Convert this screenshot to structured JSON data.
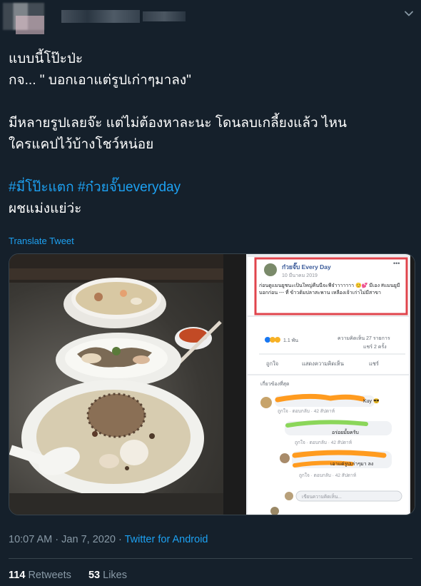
{
  "tweet": {
    "lines": [
      "แบบนี้โป๊ะป่ะ",
      "กจ... \" บอกเอาแต่รูปเก่าๆมาลง\"",
      "มีหลายรูปเลยจ๊ะ แต่ไม่ต้องหาละนะ โดนลบเกลี้ยงแล้ว ไหน",
      "ใครแคปไว้บ้างโชว์หน่อย",
      "ผชแม่งแย่ว่ะ"
    ],
    "hashtags": [
      "#มี่โป๊ะแตก",
      "#ก๋วยจั๊บeveryday"
    ]
  },
  "translate_label": "Translate Tweet",
  "screenshot_post": {
    "page_name": "ก๋วยจั๊บ Every Day",
    "date": "10 มีนาคม 2019",
    "body": "ก่อนดูแมนยูชนะเป็นใหญ่คืนนี้จะพี่จ๋าาาาาาา 😊💕 มีเอง #แมนยูมีบอกก่อน --- ที่ ข้าวต้มปลาสะพาน เหลืองเจ้าเก่าไม่มีสาขา",
    "reactions": "1.1 พัน",
    "comments_count": "ความคิดเห็น 27 รายการ",
    "shares": "แชร์ 2 ครั้ง",
    "like_label": "ถูกใจ",
    "comment_label": "แสดงความคิดเห็น",
    "share_label": "แชร์",
    "sort_label": "เกี่ยวข้องที่สุด",
    "c1_name": "Kuy 😎",
    "c1_meta": "ถูกใจ · ตอบกลับ · 42 สัปดาห์",
    "c2_text": "อร่อยมั้ยครับ",
    "c2_meta": "ถูกใจ · ตอบกลับ · 42 สัปดาห์",
    "c3_text": "เอาแต่รูปเก่าๆมา ลง",
    "c3_meta": "ถูกใจ · ตอบกลับ · 42 สัปดาห์",
    "input_placeholder": "เขียนความคิดเห็น..."
  },
  "meta": {
    "time": "10:07 AM",
    "separator": "·",
    "date": "Jan 7, 2020",
    "client": "Twitter for Android"
  },
  "stats": {
    "retweets": "114",
    "retweets_label": "Retweets",
    "likes": "53",
    "likes_label": "Likes"
  },
  "colors": {
    "background": "#15202b",
    "accent": "#1da1f2",
    "muted": "#8899a6",
    "border": "#38444d",
    "highlight_box": "#e0444c"
  }
}
